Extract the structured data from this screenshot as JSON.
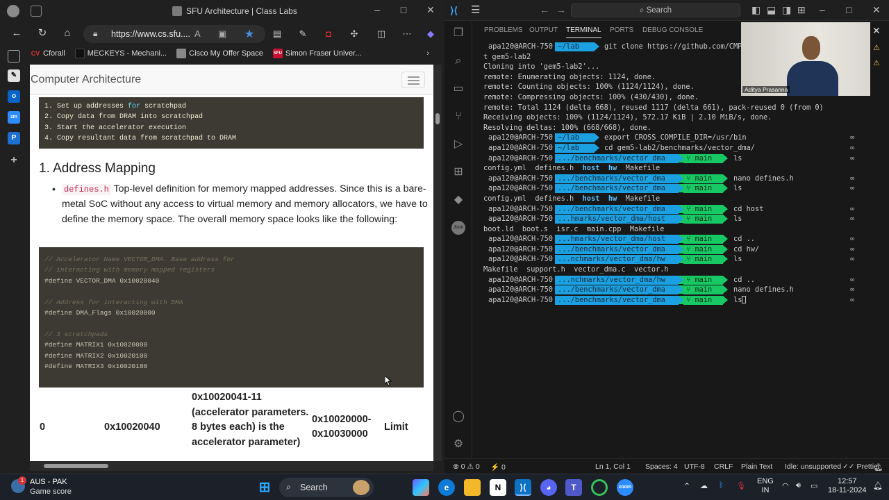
{
  "browser": {
    "tab_title": "SFU Architecture | Class Labs",
    "url": "https://www.cs.sfu....",
    "bookmarks": [
      {
        "label": "Cforall",
        "icon": "cforall-icon",
        "badge": "CV",
        "color": "#e03030"
      },
      {
        "label": "MECKEYS - Mechani...",
        "icon": "meckeys-icon",
        "badge": "",
        "color": "#111111"
      },
      {
        "label": "Cisco My Offer Space",
        "icon": "cisco-icon",
        "badge": "",
        "color": "#888888"
      },
      {
        "label": "Simon Fraser Univer...",
        "icon": "sfu-icon",
        "badge": "SFU",
        "color": "#c8102e"
      }
    ],
    "page": {
      "brand": "Computer Architecture",
      "steps": [
        "1. Set up addresses for scratchpad",
        "2. Copy data from DRAM into scratchpad",
        "3. Start the accelerator execution",
        "4. Copy resultant data from scratchpad to DRAM"
      ],
      "section_heading": "1. Address Mapping",
      "bullet_code": "defines.h",
      "bullet_text": "Top-level definition for memory mapped addresses. Since this is a bare-metal SoC without any access to virtual memory and memory allocators, we have to define the memory space. The overall memory space looks like the following:",
      "code_lines": [
        {
          "type": "comment",
          "text": "// Accelerator Name VECTOR_DMA. Base address for"
        },
        {
          "type": "comment",
          "text": "// interacting with memory mapped registers"
        },
        {
          "type": "code",
          "text": "#define VECTOR_DMA 0x10020040"
        },
        {
          "type": "blank",
          "text": ""
        },
        {
          "type": "comment",
          "text": "// Address for interacting with DMA"
        },
        {
          "type": "code",
          "text": "#define DMA_Flags 0x10020000"
        },
        {
          "type": "blank",
          "text": ""
        },
        {
          "type": "comment",
          "text": "// 3 scratchpads"
        },
        {
          "type": "code",
          "text": "#define MATRIX1 0x10020080"
        },
        {
          "type": "code",
          "text": "#define MATRIX2 0x10020100"
        },
        {
          "type": "code",
          "text": "#define MATRIX3 0x10020180"
        }
      ],
      "table_row": {
        "c1": "0",
        "c2": "0x10020040",
        "c3": "0x10020041-11 (accelerator parameters. 8 bytes each) is the accelerator parameter)",
        "c4": "0x10020000-0x10030000",
        "c5": "Limit"
      }
    }
  },
  "vscode": {
    "search_placeholder": "Search",
    "panel_tabs": [
      "PROBLEMS",
      "OUTPUT",
      "TERMINAL",
      "PORTS",
      "DEBUG CONSOLE"
    ],
    "active_tab": "TERMINAL",
    "webcam_name": "Aditya Prasanna",
    "terminal": [
      {
        "kind": "prompt",
        "user": "apa120@ARCH-750",
        "path": "~/lab",
        "branch": "",
        "cmd": "git clone https://github.com/CMPT"
      },
      {
        "kind": "out",
        "text": "t gem5-lab2"
      },
      {
        "kind": "out",
        "text": "Cloning into 'gem5-lab2'..."
      },
      {
        "kind": "out",
        "text": "remote: Enumerating objects: 1124, done."
      },
      {
        "kind": "out",
        "text": "remote: Counting objects: 100% (1124/1124), done."
      },
      {
        "kind": "out",
        "text": "remote: Compressing objects: 100% (430/430), done."
      },
      {
        "kind": "out",
        "text": "remote: Total 1124 (delta 668), reused 1117 (delta 661), pack-reused 0 (from 0)"
      },
      {
        "kind": "out",
        "text": "Receiving objects: 100% (1124/1124), 572.17 KiB | 2.10 MiB/s, done."
      },
      {
        "kind": "out",
        "text": "Resolving deltas: 100% (668/668), done."
      },
      {
        "kind": "prompt",
        "user": "apa120@ARCH-750",
        "path": "~/lab",
        "branch": "",
        "cmd": "export CROSS_COMPILE_DIR=/usr/bin"
      },
      {
        "kind": "prompt",
        "user": "apa120@ARCH-750",
        "path": "~/lab",
        "branch": "",
        "cmd": "cd gem5-lab2/benchmarks/vector_dma/"
      },
      {
        "kind": "prompt",
        "user": "apa120@ARCH-750",
        "path": ".../benchmarks/vector_dma",
        "branch": "main",
        "cmd": "ls"
      },
      {
        "kind": "ls",
        "items": [
          {
            "t": "config.yml",
            "d": false
          },
          {
            "t": "defines.h",
            "d": false
          },
          {
            "t": "host",
            "d": true
          },
          {
            "t": "hw",
            "d": true
          },
          {
            "t": "Makefile",
            "d": false
          }
        ]
      },
      {
        "kind": "prompt",
        "user": "apa120@ARCH-750",
        "path": ".../benchmarks/vector_dma",
        "branch": "main",
        "cmd": "nano defines.h"
      },
      {
        "kind": "prompt",
        "user": "apa120@ARCH-750",
        "path": ".../benchmarks/vector_dma",
        "branch": "main",
        "cmd": "ls"
      },
      {
        "kind": "ls",
        "items": [
          {
            "t": "config.yml",
            "d": false
          },
          {
            "t": "defines.h",
            "d": false
          },
          {
            "t": "host",
            "d": true
          },
          {
            "t": "hw",
            "d": true
          },
          {
            "t": "Makefile",
            "d": false
          }
        ]
      },
      {
        "kind": "prompt",
        "user": "apa120@ARCH-750",
        "path": ".../benchmarks/vector_dma",
        "branch": "main",
        "cmd": "cd host"
      },
      {
        "kind": "prompt",
        "user": "apa120@ARCH-750",
        "path": "...hmarks/vector_dma/host",
        "branch": "main",
        "cmd": "ls"
      },
      {
        "kind": "ls",
        "items": [
          {
            "t": "boot.ld",
            "d": false
          },
          {
            "t": "boot.s",
            "d": false
          },
          {
            "t": "isr.c",
            "d": false
          },
          {
            "t": "main.cpp",
            "d": false
          },
          {
            "t": "Makefile",
            "d": false
          }
        ]
      },
      {
        "kind": "prompt",
        "user": "apa120@ARCH-750",
        "path": "...hmarks/vector_dma/host",
        "branch": "main",
        "cmd": "cd .."
      },
      {
        "kind": "prompt",
        "user": "apa120@ARCH-750",
        "path": ".../benchmarks/vector_dma",
        "branch": "main",
        "cmd": "cd hw/"
      },
      {
        "kind": "prompt",
        "user": "apa120@ARCH-750",
        "path": "...nchmarks/vector_dma/hw",
        "branch": "main",
        "cmd": "ls"
      },
      {
        "kind": "ls",
        "items": [
          {
            "t": "Makefile",
            "d": false
          },
          {
            "t": "support.h",
            "d": false
          },
          {
            "t": "vector_dma.c",
            "d": false
          },
          {
            "t": "vector.h",
            "d": false
          }
        ]
      },
      {
        "kind": "prompt",
        "user": "apa120@ARCH-750",
        "path": "...nchmarks/vector_dma/hw",
        "branch": "main",
        "cmd": "cd .."
      },
      {
        "kind": "prompt",
        "user": "apa120@ARCH-750",
        "path": ".../benchmarks/vector_dma",
        "branch": "main",
        "cmd": "nano defines.h"
      },
      {
        "kind": "prompt",
        "user": "apa120@ARCH-750",
        "path": ".../benchmarks/vector_dma",
        "branch": "main",
        "cmd": "ls",
        "cursor": true
      }
    ],
    "infinity_glyph": "∞",
    "status": {
      "errors": "0",
      "warnings": "0",
      "ports": "0",
      "position": "Ln 1, Col 1",
      "spaces": "Spaces: 4",
      "encoding": "UTF-8",
      "eol": "CRLF",
      "language": "Plain Text",
      "idle": "Idle: unsupported",
      "prettier": "Prettier"
    }
  },
  "taskbar": {
    "weather_title": "AUS - PAK",
    "weather_sub": "Game score",
    "weather_badge": "1",
    "search_label": "Search",
    "lang_top": "ENG",
    "lang_bottom": "IN",
    "time": "12:57",
    "date": "18-11-2024"
  },
  "colors": {
    "path_segment": "#1ba1e2",
    "branch_segment": "#17c964",
    "accent": "#3ea6ff"
  }
}
